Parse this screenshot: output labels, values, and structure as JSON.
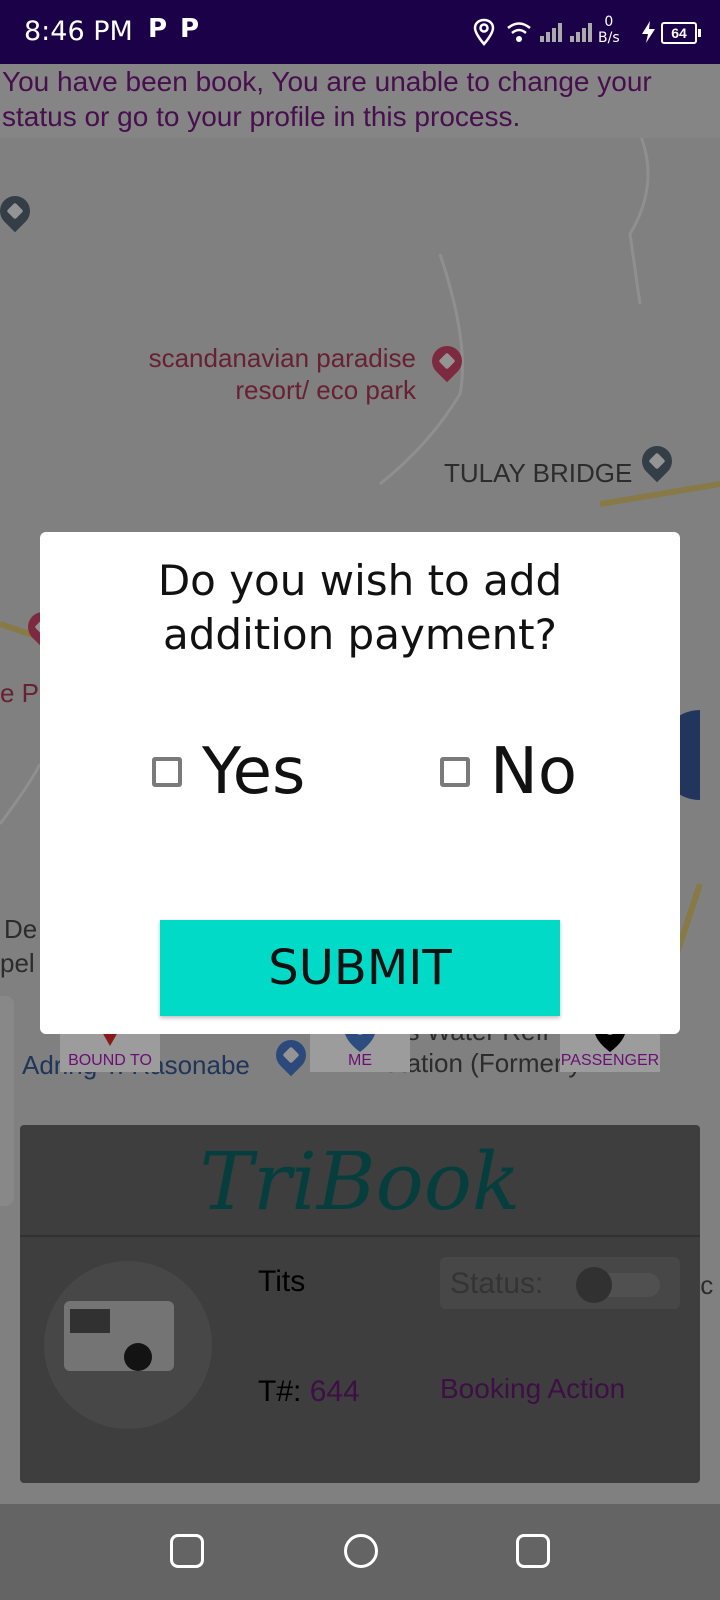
{
  "status_bar": {
    "time": "8:46 PM",
    "notif_icon_1": "P",
    "notif_icon_2": "P",
    "data_rate_value": "0",
    "data_rate_unit": "B/s",
    "battery_level": "64"
  },
  "notice": {
    "text": "You have been book, You are unable to change your status or go to your profile in this process."
  },
  "map": {
    "labels": {
      "poi_1_line1": "scandanavian paradise",
      "poi_1_line2": "resort/ eco park",
      "tulay_bridge": "TULAY BRIDGE",
      "left_partial_1": "e Pa",
      "left_partial_2": "De",
      "left_partial_3": "pel",
      "adring": "Adring T. Rasonabe",
      "water_line1": "es Water Refi",
      "water_line2": "Station (Formerly…",
      "right_partial": "hic"
    },
    "markers": {
      "bound_to": "BOUND TO",
      "me": "ME",
      "passenger": "PASSENGER"
    }
  },
  "dialog": {
    "title_line1": "Do you wish to add",
    "title_line2": "addition payment?",
    "option_yes": "Yes",
    "option_no": "No",
    "submit": "SUBMIT"
  },
  "card": {
    "logo_text": "TriBook",
    "driver_name": "Tits",
    "status_label": "Status:",
    "tnum_label": "T#:",
    "tnum_value": "644",
    "booking_action": "Booking Action"
  },
  "colors": {
    "statusbar": "#1b0147",
    "accent_teal": "#00dac7",
    "purple_text": "#7a1a86",
    "logo_teal": "#0b6b6b"
  },
  "icons": [
    "location-icon",
    "wifi-icon",
    "signal-icon",
    "charging-icon",
    "battery-icon",
    "hotel-pin-icon",
    "bridge-pin-icon",
    "shopping-pin-icon",
    "recents-icon",
    "home-icon",
    "back-icon"
  ]
}
